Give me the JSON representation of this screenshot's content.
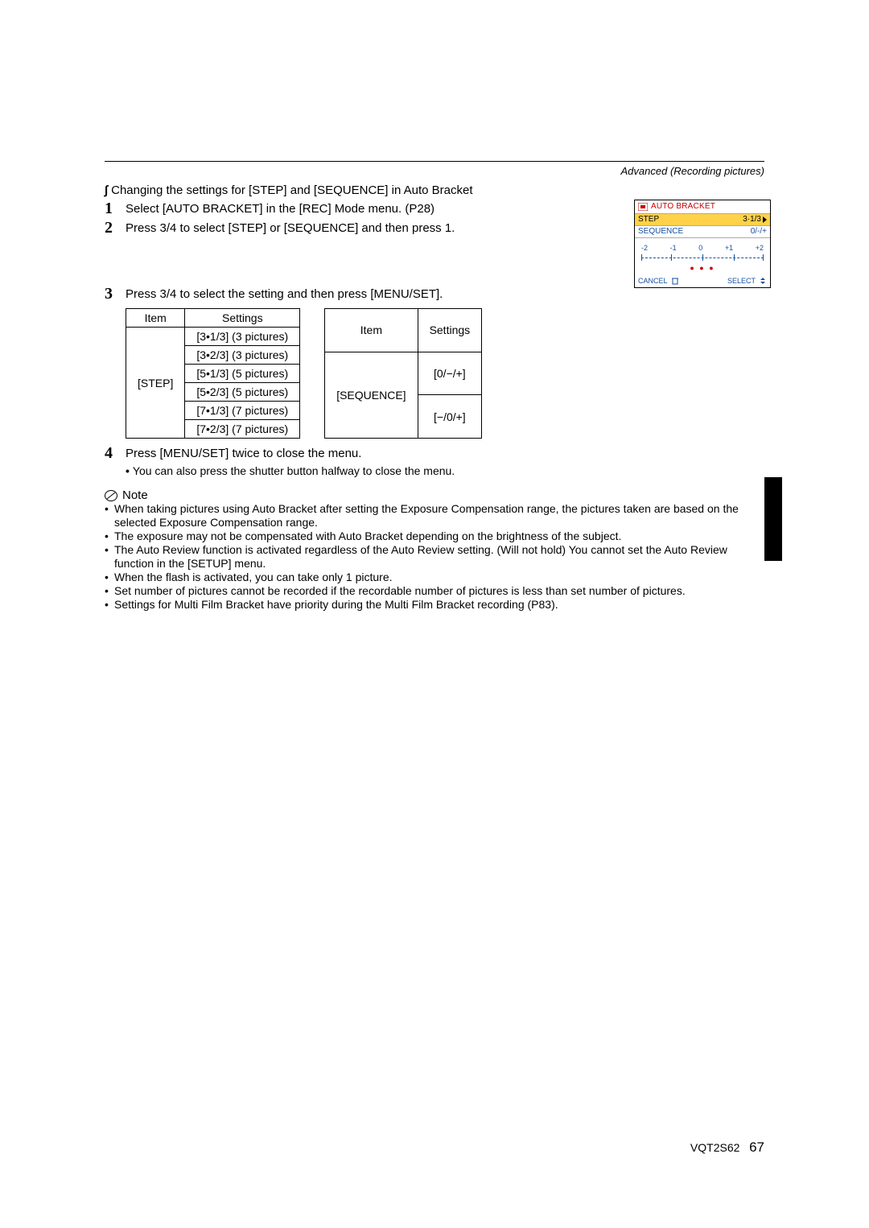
{
  "header": {
    "section": "Advanced (Recording pictures)"
  },
  "subheading": {
    "marker": "∫",
    "text": "Changing the settings for [STEP] and [SEQUENCE] in Auto Bracket"
  },
  "steps": {
    "s1": {
      "num": "1",
      "text": "Select [AUTO BRACKET] in the [REC] Mode menu. (P28)"
    },
    "s2": {
      "num": "2",
      "text": "Press 3/4 to select [STEP] or [SEQUENCE] and then press 1."
    },
    "s3": {
      "num": "3",
      "text": "Press 3/4 to select the setting and then press [MENU/SET]."
    },
    "s4": {
      "num": "4",
      "text": "Press [MENU/SET] twice to close the menu.",
      "sub": "You can also press the shutter button halfway to close the menu."
    }
  },
  "table_step": {
    "headers": {
      "item": "Item",
      "settings": "Settings"
    },
    "item": "[STEP]",
    "rows": [
      "[3•1/3] (3 pictures)",
      "[3•2/3] (3 pictures)",
      "[5•1/3] (5 pictures)",
      "[5•2/3] (5 pictures)",
      "[7•1/3] (7 pictures)",
      "[7•2/3] (7 pictures)"
    ]
  },
  "table_seq": {
    "headers": {
      "item": "Item",
      "settings": "Settings"
    },
    "item": "[SEQUENCE]",
    "rows": [
      "[0/−/+]",
      "[−/0/+]"
    ]
  },
  "note_label": "Note",
  "notes": [
    "When taking pictures using Auto Bracket after setting the Exposure Compensation range, the pictures taken are based on the selected Exposure Compensation range.",
    "The exposure may not be compensated with Auto Bracket depending on the brightness of the subject.",
    "The Auto Review function is activated regardless of the Auto Review setting. (Will not hold) You cannot set the Auto Review function in the [SETUP] menu.",
    "When the flash is activated, you can take only 1 picture.",
    "Set number of pictures cannot be recorded if the recordable number of pictures is less than set number of pictures.",
    "Settings for Multi Film Bracket have priority during the Multi Film Bracket recording (P83)."
  ],
  "diagram": {
    "title": "AUTO BRACKET",
    "step_label": "STEP",
    "step_value": "3·1/3",
    "seq_label": "SEQUENCE",
    "seq_value": "0/-/+",
    "ticks": [
      "-2",
      "-1",
      "0",
      "+1",
      "+2"
    ],
    "dots": "● ● ●",
    "footer_cancel": "CANCEL",
    "footer_select": "SELECT"
  },
  "footer": {
    "code": "VQT2S62",
    "page": "67"
  }
}
